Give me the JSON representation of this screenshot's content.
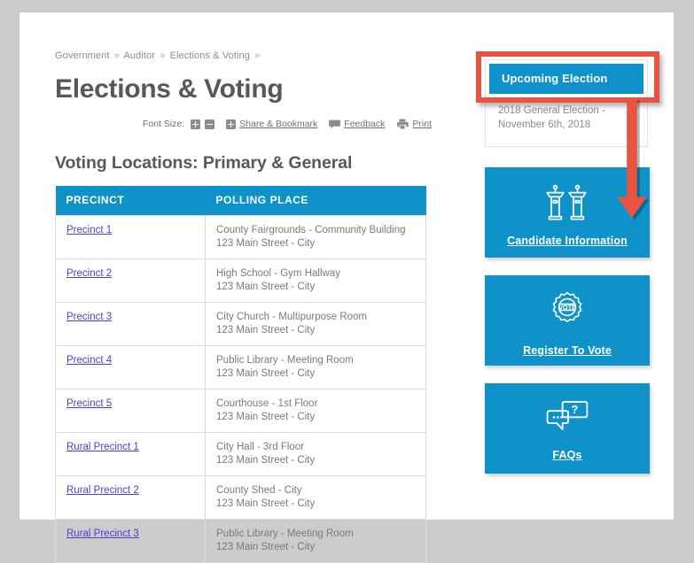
{
  "breadcrumb": {
    "items": [
      "Government",
      "Auditor",
      "Elections & Voting"
    ],
    "separator": "»",
    "trailing": "»"
  },
  "header": {
    "title": "Elections & Voting"
  },
  "page_tools": {
    "font_size_label": "Font Size:",
    "font_increase_icon": "plus-square-icon",
    "font_decrease_icon": "minus-square-icon",
    "share_icon": "plus-square-icon",
    "share_label": "Share & Bookmark",
    "feedback_icon": "speech-bubble-icon",
    "feedback_label": "Feedback",
    "print_icon": "printer-icon",
    "print_label": "Print"
  },
  "main": {
    "section_heading": "Voting Locations: Primary & General",
    "table": {
      "columns": [
        "PRECINCT",
        "POLLING PLACE"
      ],
      "rows": [
        {
          "precinct": "Precinct 1",
          "place": "County Fairgrounds - Community Building",
          "address": "123 Main Street - City"
        },
        {
          "precinct": "Precinct 2",
          "place": "High School - Gym Hallway",
          "address": "123 Main Street - City"
        },
        {
          "precinct": "Precinct 3",
          "place": "City Church - Multipurpose Room",
          "address": "123 Main Street - City"
        },
        {
          "precinct": "Precinct 4",
          "place": "Public Library - Meeting Room",
          "address": "123 Main Street - City"
        },
        {
          "precinct": "Precinct 5",
          "place": "Courthouse - 1st Floor",
          "address": "123 Main Street - City"
        },
        {
          "precinct": "Rural Precinct 1",
          "place": "City Hall - 3rd Floor",
          "address": "123 Main Street - City"
        },
        {
          "precinct": "Rural Precinct 2",
          "place": "County Shed - City",
          "address": "123 Main Street - City"
        },
        {
          "precinct": "Rural Precinct 3",
          "place": "Public Library - Meeting Room",
          "address": "123 Main Street - City"
        }
      ]
    }
  },
  "sidebar": {
    "election_widget": {
      "heading": "Upcoming Election",
      "body_line1": "2018 General Election -",
      "body_line2": "November 6th, 2018"
    },
    "tiles": [
      {
        "label": "Candidate Information",
        "icon": "podiums-icon"
      },
      {
        "label": "Register To Vote",
        "icon": "vote-badge-icon",
        "badge_text": "VOTE"
      },
      {
        "label": "FAQs",
        "icon": "speech-bubbles-question-icon"
      }
    ]
  },
  "annotation": {
    "highlight_target": "Upcoming Election",
    "arrow_direction": "down",
    "color": "#e8543f"
  },
  "colors": {
    "accent_blue": "#0f92c9",
    "annotation_red": "#e8543f",
    "page_background": "#cccccc",
    "sheet_background": "#ffffff",
    "heading_text": "#58585a",
    "body_text": "#7a7a7a",
    "link_text": "#4b3fd4"
  }
}
